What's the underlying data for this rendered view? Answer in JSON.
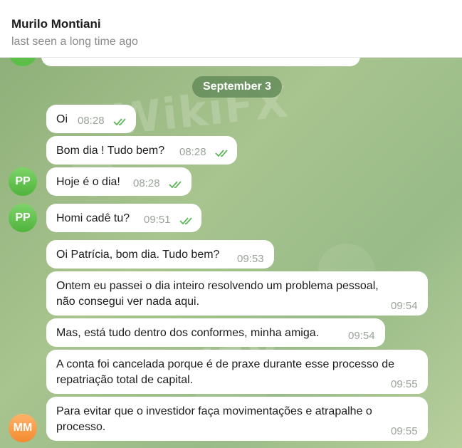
{
  "header": {
    "contact_name": "Murilo Montiani",
    "status": "last seen a long time ago"
  },
  "chat": {
    "date_separator": "September 3",
    "watermark": "WikiFX",
    "messages": [
      {
        "text": "Oi",
        "time": "08:28",
        "read": true
      },
      {
        "text": "Bom dia ! Tudo bem?",
        "time": "08:28",
        "read": true
      },
      {
        "text": "Hoje é o dia!",
        "time": "08:28",
        "read": true,
        "avatar": "PP"
      },
      {
        "text": "Homi cadê tu?",
        "time": "09:51",
        "read": true,
        "avatar": "PP"
      },
      {
        "text": "Oi Patrícia, bom dia. Tudo bem?",
        "time": "09:53"
      },
      {
        "line1": "Ontem eu passei o dia inteiro resolvendo um problema pessoal,",
        "line2": "não consegui ver nada aqui.",
        "time": "09:54"
      },
      {
        "text": "Mas, está tudo dentro dos conformes, minha amiga.",
        "time": "09:54"
      },
      {
        "line1": "A conta foi cancelada porque é de praxe durante esse processo de",
        "line2": "repatriação total de capital.",
        "time": "09:55"
      },
      {
        "line1": "Para evitar que o investidor faça movimentações e atrapalhe o",
        "line2": "processo.",
        "time": "09:55",
        "avatar": "MM"
      }
    ]
  },
  "colors": {
    "outgoing_check": "#5fb85a",
    "avatar_pp": "#5cbf47",
    "avatar_mm": "#f5923a"
  }
}
